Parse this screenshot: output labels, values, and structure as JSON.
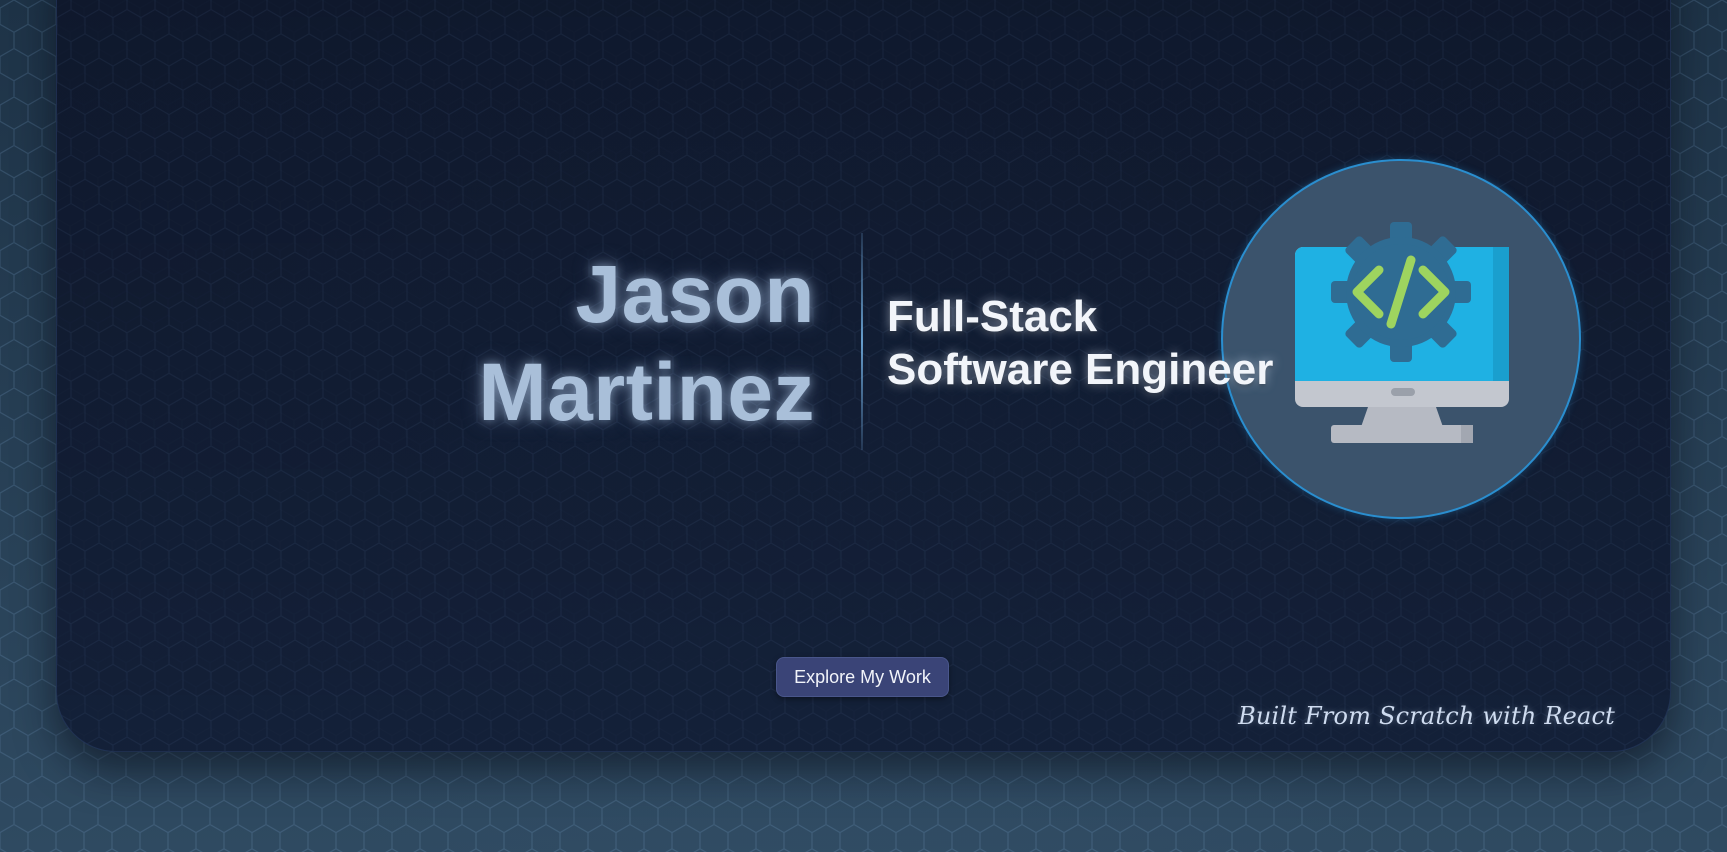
{
  "hero": {
    "name_first": "Jason",
    "name_last": "Martinez",
    "title_line1": "Full-Stack",
    "title_line2": "Software Engineer",
    "explore_button": "Explore My Work",
    "footer_note": "Built From Scratch with React",
    "avatar_icon": "monitor-code-gear-icon"
  },
  "colors": {
    "page_background": "#2b4257",
    "card_background": "#111b33",
    "name_text": "#a9bfd9",
    "title_text": "#f2f5fa",
    "button_background": "#3a4477",
    "avatar_circle": "#3b536c",
    "avatar_border": "#2a8ecf",
    "monitor_screen": "#1fb1e3",
    "code_symbol": "#9ed45f"
  }
}
